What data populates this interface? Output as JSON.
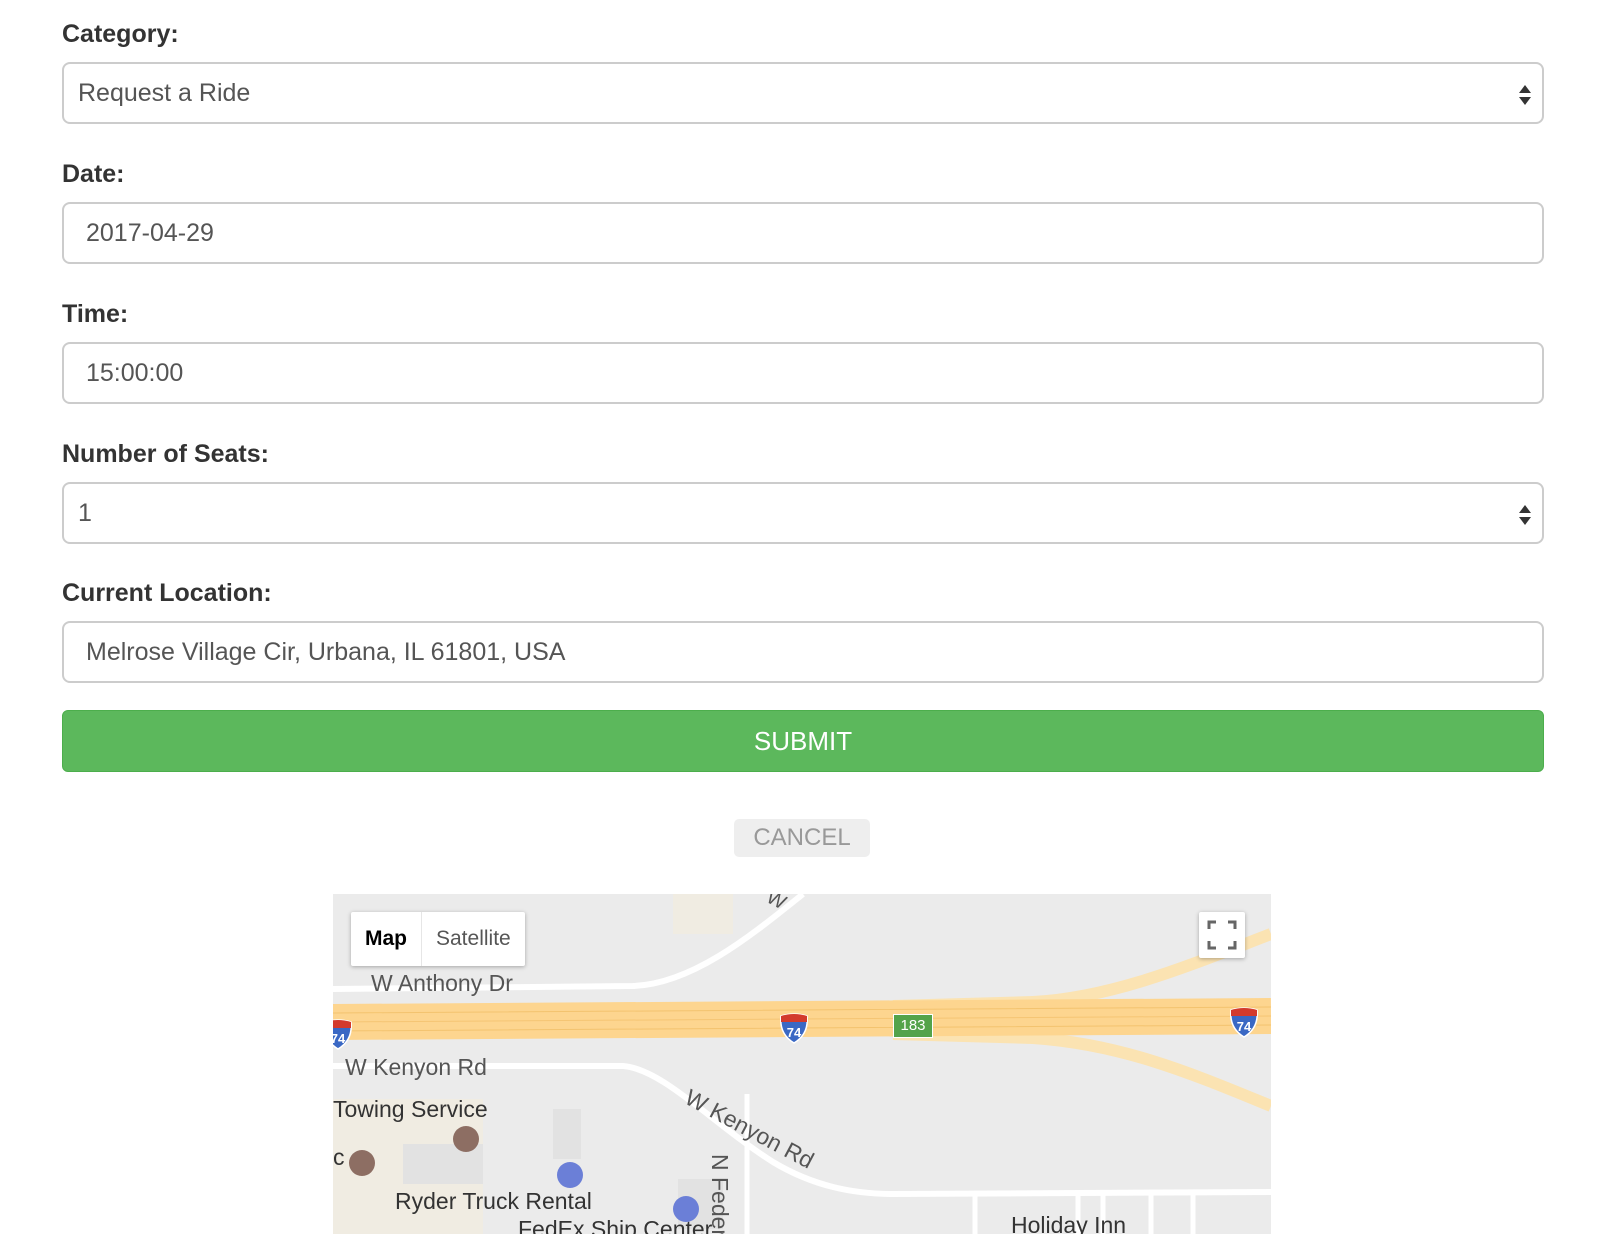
{
  "form": {
    "category_label": "Category:",
    "category_value": "Request a Ride",
    "date_label": "Date:",
    "date_value": "2017-04-29",
    "time_label": "Time:",
    "time_value": "15:00:00",
    "seats_label": "Number of Seats:",
    "seats_value": "1",
    "location_label": "Current Location:",
    "location_value": "Melrose Village Cir, Urbana, IL 61801, USA",
    "submit_label": "SUBMIT",
    "cancel_label": "CANCEL"
  },
  "map": {
    "type_map": "Map",
    "type_satellite": "Satellite",
    "shield_74": "74",
    "route_183": "183",
    "labels": {
      "anthony": "W Anthony Dr",
      "kenyon_h": "W Kenyon Rd",
      "kenyon_d": "W Kenyon Rd",
      "towing": "Towing Service",
      "ryder": "Ryder Truck Rental",
      "fedex": "FedEx Ship Center",
      "federal": "N Federa",
      "holiday": "Holiday Inn",
      "partial_w": "W",
      "partial_c": "c"
    }
  },
  "colors": {
    "submit": "#5cb85c",
    "highway": "#fdd58f",
    "map_bg": "#ebebeb"
  }
}
